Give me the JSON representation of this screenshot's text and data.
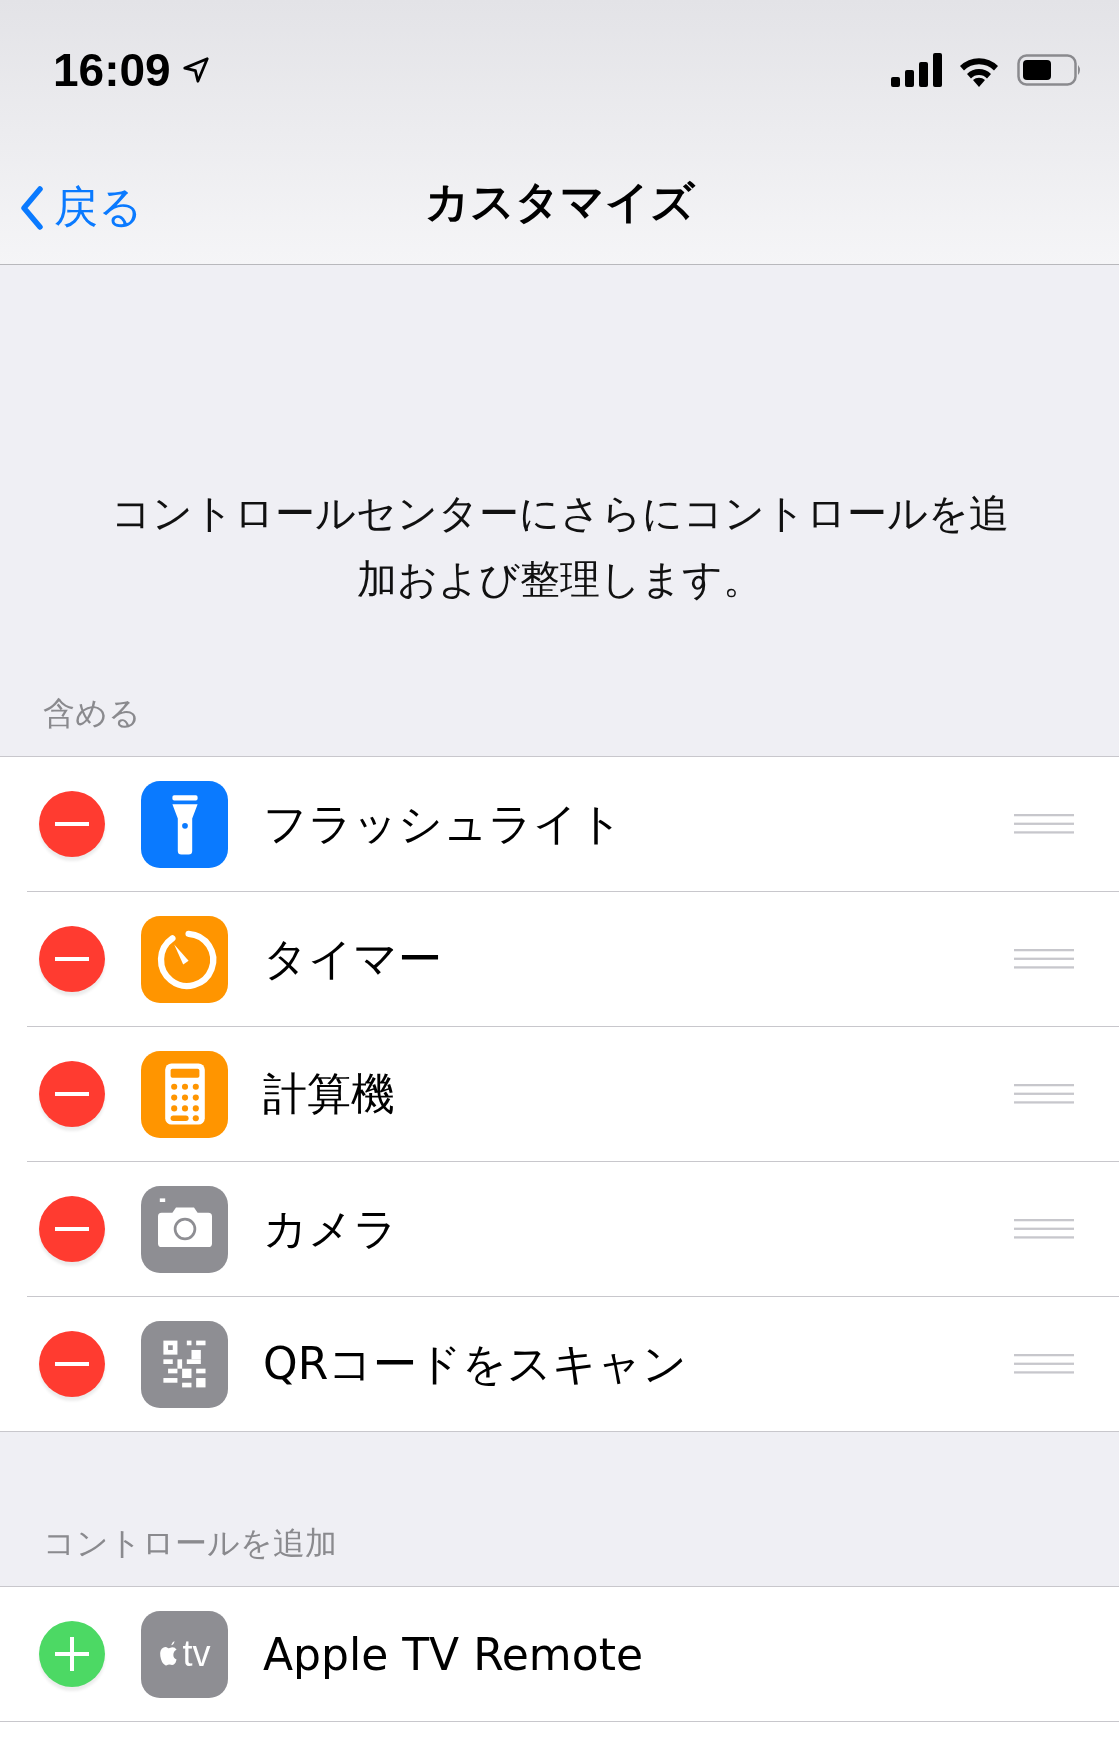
{
  "status_bar": {
    "time": "16:09"
  },
  "nav": {
    "back": "戻る",
    "title": "カスタマイズ"
  },
  "description": "コントロールセンターにさらにコントロールを追加および整理します。",
  "sections": [
    {
      "header": "含める",
      "kind": "remove",
      "items": [
        {
          "label": "フラッシュライト",
          "kind": "flashlight",
          "color": "#0a7aff"
        },
        {
          "label": "タイマー",
          "kind": "timer",
          "color": "#ff9500"
        },
        {
          "label": "計算機",
          "kind": "calculator",
          "color": "#ff9500"
        },
        {
          "label": "カメラ",
          "kind": "camera",
          "color": "#8e8e93"
        },
        {
          "label": "QRコードをスキャン",
          "kind": "qr",
          "color": "#8e8e93"
        }
      ]
    },
    {
      "header": "コントロールを追加",
      "kind": "add",
      "items": [
        {
          "label": "Apple TV Remote",
          "kind": "appletv",
          "color": "#8e8e93",
          "icon_text": "tv"
        }
      ]
    }
  ]
}
